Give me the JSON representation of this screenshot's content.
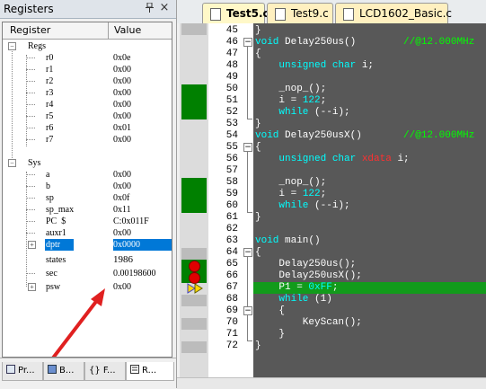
{
  "registers_pane": {
    "title": "Registers",
    "pin_icon": "pin-icon",
    "close_glyph": "×",
    "header": {
      "col1": "Register",
      "col2": "Value"
    },
    "groups": [
      {
        "name": "Regs",
        "items": [
          {
            "name": "r0",
            "value": "0x0e"
          },
          {
            "name": "r1",
            "value": "0x00"
          },
          {
            "name": "r2",
            "value": "0x00"
          },
          {
            "name": "r3",
            "value": "0x00"
          },
          {
            "name": "r4",
            "value": "0x00"
          },
          {
            "name": "r5",
            "value": "0x00"
          },
          {
            "name": "r6",
            "value": "0x01"
          },
          {
            "name": "r7",
            "value": "0x00"
          }
        ]
      },
      {
        "name": "Sys",
        "items": [
          {
            "name": "a",
            "value": "0x00"
          },
          {
            "name": "b",
            "value": "0x00"
          },
          {
            "name": "sp",
            "value": "0x0f"
          },
          {
            "name": "sp_max",
            "value": "0x11"
          },
          {
            "name": "PC  $",
            "value": "C:0x011F"
          },
          {
            "name": "auxr1",
            "value": "0x00"
          },
          {
            "name": "dptr",
            "value": "0x0000",
            "expandable": true,
            "selected": true
          },
          {
            "name": "states",
            "value": "1986"
          },
          {
            "name": "sec",
            "value": "0.00198600"
          },
          {
            "name": "psw",
            "value": "0x00",
            "expandable": true
          }
        ]
      }
    ],
    "bottom_tabs": [
      {
        "label": "Pr...",
        "icon": "project-icon"
      },
      {
        "label": "B...",
        "icon": "books-icon"
      },
      {
        "label": "{} F...",
        "icon": "functions-icon"
      },
      {
        "label": "R...",
        "icon": "registers-icon",
        "active": true
      }
    ]
  },
  "file_tabs": [
    {
      "label": "Test5.c",
      "active": true
    },
    {
      "label": "Test9.c"
    },
    {
      "label": "LCD1602_Basic.c"
    }
  ],
  "code_lines": [
    {
      "n": "45",
      "text": "}"
    },
    {
      "n": "46",
      "text": "void Delay250us()        //@12.000MHz"
    },
    {
      "n": "47",
      "text": "{"
    },
    {
      "n": "48",
      "text": "    unsigned char i;"
    },
    {
      "n": "49",
      "text": ""
    },
    {
      "n": "50",
      "text": "    _nop_();"
    },
    {
      "n": "51",
      "text": "    i = 122;"
    },
    {
      "n": "52",
      "text": "    while (--i);"
    },
    {
      "n": "53",
      "text": "}"
    },
    {
      "n": "54",
      "text": "void Delay250usX()       //@12.000MHz"
    },
    {
      "n": "55",
      "text": "{"
    },
    {
      "n": "56",
      "text": "    unsigned char xdata i;"
    },
    {
      "n": "57",
      "text": ""
    },
    {
      "n": "58",
      "text": "    _nop_();"
    },
    {
      "n": "59",
      "text": "    i = 122;"
    },
    {
      "n": "60",
      "text": "    while (--i);"
    },
    {
      "n": "61",
      "text": "}"
    },
    {
      "n": "62",
      "text": ""
    },
    {
      "n": "63",
      "text": "void main()"
    },
    {
      "n": "64",
      "text": "{"
    },
    {
      "n": "65",
      "text": "    Delay250us();"
    },
    {
      "n": "66",
      "text": "    Delay250usX();"
    },
    {
      "n": "67",
      "text": "    P1 = 0xFF;"
    },
    {
      "n": "68",
      "text": "    while (1)"
    },
    {
      "n": "69",
      "text": "    {"
    },
    {
      "n": "70",
      "text": "        KeyScan();"
    },
    {
      "n": "71",
      "text": "    }"
    },
    {
      "n": "72",
      "text": "}"
    }
  ],
  "colors": {
    "selection": "#0078d7",
    "code_bg": "#585858",
    "current_line": "#129b1b",
    "coverage_green": "#008000",
    "keyword": "#00ffff",
    "comment": "#00ff00",
    "xdata": "#ff3030",
    "annotation_arrow": "#e02020"
  },
  "annotation": {
    "type": "arrow",
    "icon": "red-arrow-icon",
    "points_to": "states"
  }
}
